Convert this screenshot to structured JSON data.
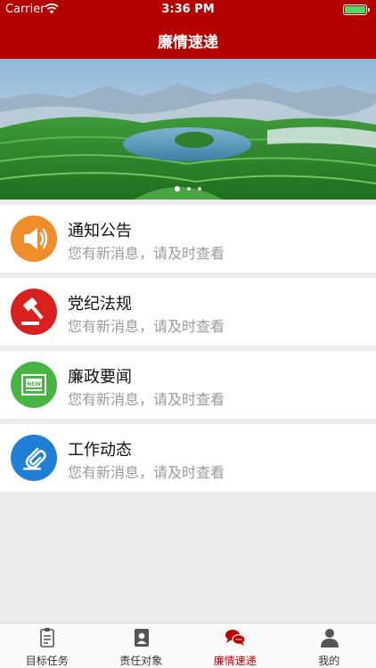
{
  "status": {
    "carrier": "Carrier",
    "time": "3:36 PM",
    "battery_level": 1.0
  },
  "nav": {
    "title": "廉情速递"
  },
  "banner": {
    "slide_count": 3,
    "active_index": 0
  },
  "items": [
    {
      "title": "通知公告",
      "subtitle": "您有新消息，请及时查看",
      "icon": "speaker-icon",
      "color": "#f08d2b"
    },
    {
      "title": "党纪法规",
      "subtitle": "您有新消息，请及时查看",
      "icon": "gavel-icon",
      "color": "#d9201e"
    },
    {
      "title": "廉政要闻",
      "subtitle": "您有新消息，请及时查看",
      "icon": "news-icon",
      "color": "#48b443"
    },
    {
      "title": "工作动态",
      "subtitle": "您有新消息，请及时查看",
      "icon": "paperclip-icon",
      "color": "#1f7fd6"
    }
  ],
  "tabs": [
    {
      "label": "目标任务",
      "icon": "clipboard-icon",
      "active": false
    },
    {
      "label": "责任对象",
      "icon": "contacts-icon",
      "active": false
    },
    {
      "label": "廉情速递",
      "icon": "chat-bubbles-icon",
      "active": true
    },
    {
      "label": "我的",
      "icon": "person-icon",
      "active": false
    }
  ],
  "colors": {
    "brand_red": "#b30000",
    "tab_active": "#c00000"
  }
}
